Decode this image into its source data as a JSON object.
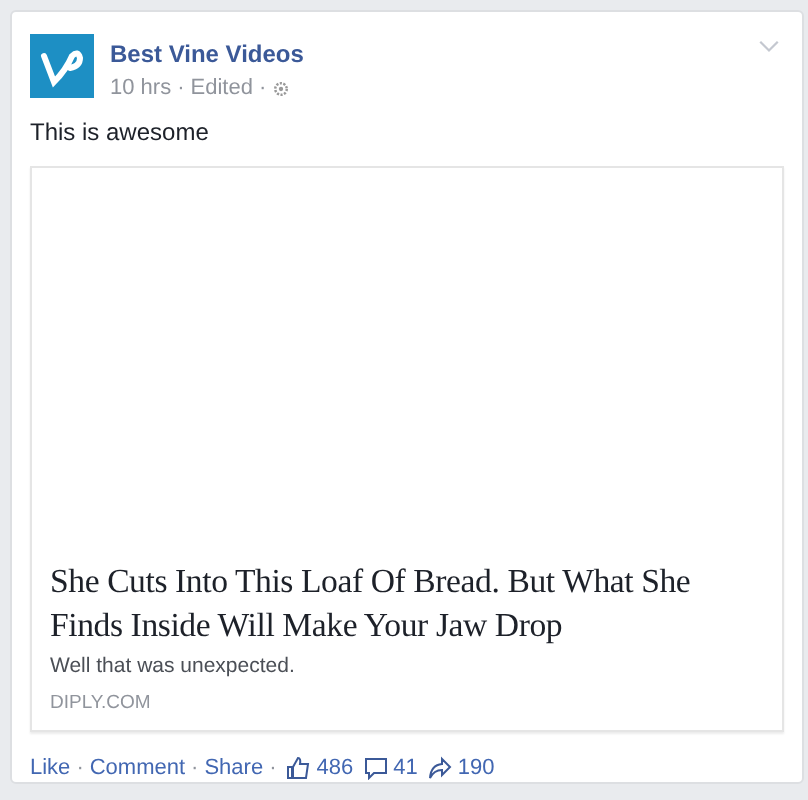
{
  "post": {
    "author": "Best Vine Videos",
    "time": "10 hrs",
    "edited": "Edited",
    "separator": "·",
    "text": "This is awesome"
  },
  "link": {
    "title": "She Cuts Into This Loaf Of Bread. But What She Finds Inside Will Make Your Jaw Drop",
    "description": "Well that was unexpected.",
    "domain": "DIPLY.COM"
  },
  "actions": [
    {
      "label": "Like",
      "separator": "·"
    },
    {
      "label": "Comment",
      "separator": "·"
    },
    {
      "label": "Share",
      "separator": "·"
    }
  ],
  "counts": [
    {
      "kind": "likes",
      "value": "486"
    },
    {
      "kind": "comments",
      "value": "41"
    },
    {
      "kind": "shares",
      "value": "190"
    }
  ]
}
